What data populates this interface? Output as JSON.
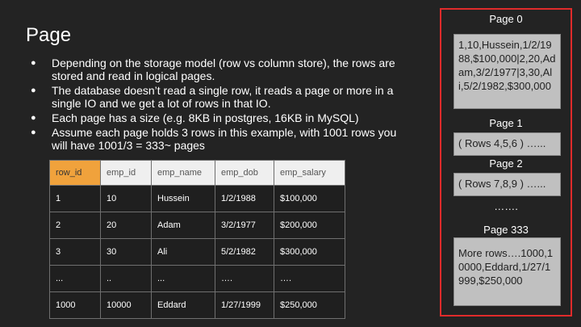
{
  "slide": {
    "title": "Page",
    "bullets": [
      "Depending on the storage model (row vs column store), the rows are stored and read in logical pages.",
      "The database doesn’t read a single row, it reads a page or more in a single IO and we get a lot of rows in that IO.",
      "Each page has a size (e.g. 8KB in postgres, 16KB in MySQL)",
      "Assume each page holds 3 rows in this example, with 1001 rows you will have 1001/3 = 333~ pages"
    ]
  },
  "table": {
    "headers": [
      "row_id",
      "emp_id",
      "emp_name",
      "emp_dob",
      "emp_salary"
    ],
    "rows": [
      [
        "1",
        "10",
        "Hussein",
        "1/2/1988",
        "$100,000"
      ],
      [
        "2",
        "20",
        "Adam",
        "3/2/1977",
        "$200,000"
      ],
      [
        "3",
        "30",
        "Ali",
        "5/2/1982",
        "$300,000"
      ],
      [
        "...",
        "..",
        "...",
        "….",
        "…."
      ],
      [
        "1000",
        "10000",
        "Eddard",
        "1/27/1999",
        "$250,000"
      ]
    ]
  },
  "pages": {
    "page0_label": "Page 0",
    "page0_content": "1,10,Hussein,1/2/1988,$100,000|2,20,Adam,3/2/1977|3,30,Ali,5/2/1982,$300,000",
    "page1_label": "Page 1",
    "page1_content": "( Rows 4,5,6 ) …...",
    "page2_label": "Page 2",
    "page2_content": "( Rows 7,8,9 ) …...",
    "ellipsis": "…….",
    "page333_label": "Page 333",
    "page333_content": "More rows….1000,10000,Eddard,1/27/1999,$250,000"
  },
  "colors": {
    "background": "#232323",
    "panel_border": "#e02b2b",
    "key_header": "#f0a23c",
    "page_box": "#c0c0c0"
  }
}
